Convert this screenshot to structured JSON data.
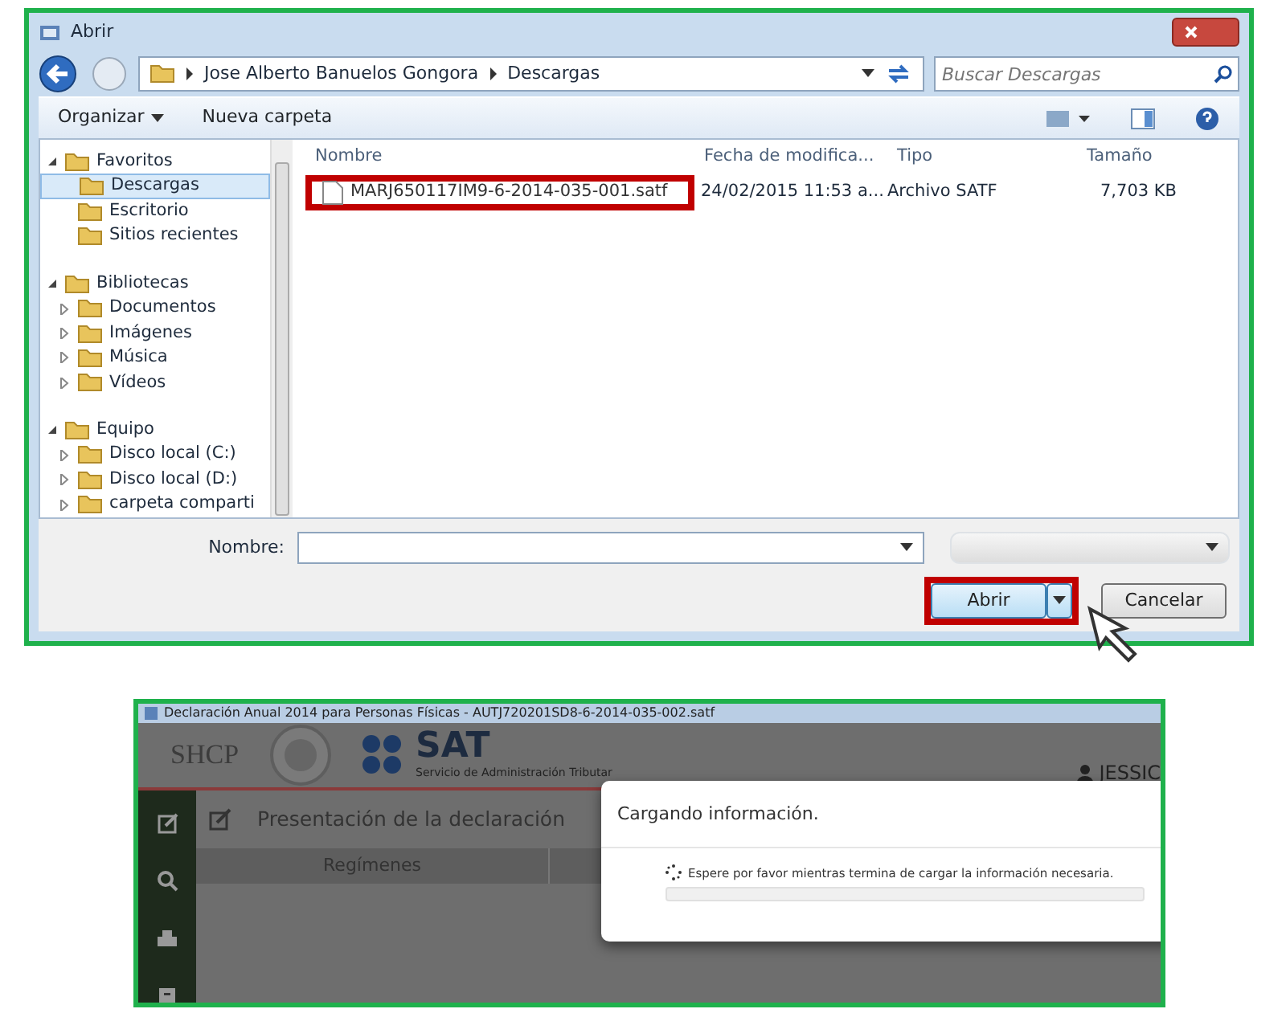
{
  "open_dialog": {
    "title": "Abrir",
    "breadcrumb": [
      "Jose Alberto Banuelos Gongora",
      "Descargas"
    ],
    "search": {
      "placeholder": "Buscar Descargas"
    },
    "toolbar": [
      "Organizar",
      "Nueva carpeta"
    ],
    "nav": [
      {
        "label": "Favoritos",
        "expanded": true,
        "selected": false,
        "children": [
          {
            "label": "Descargas",
            "selected": true
          },
          {
            "label": "Escritorio",
            "selected": false
          },
          {
            "label": "Sitios recientes",
            "selected": false
          }
        ]
      },
      {
        "label": "Bibliotecas",
        "expanded": true,
        "selected": false,
        "children": [
          {
            "label": "Documentos",
            "expanded": false,
            "selected": false
          },
          {
            "label": "Imágenes",
            "expanded": false,
            "selected": false
          },
          {
            "label": "Música",
            "expanded": false,
            "selected": false
          },
          {
            "label": "Vídeos",
            "expanded": false,
            "selected": false
          }
        ]
      },
      {
        "label": "Equipo",
        "expanded": true,
        "selected": false,
        "children": [
          {
            "label": "Disco local (C:)",
            "expanded": false,
            "selected": false
          },
          {
            "label": "Disco local (D:)",
            "expanded": false,
            "selected": false
          },
          {
            "label": "carpeta comparti",
            "expanded": false,
            "selected": false
          }
        ]
      }
    ],
    "columns": [
      "Nombre",
      "Fecha de modifica...",
      "Tipo",
      "Tamaño"
    ],
    "files": [
      {
        "name": "MARJ650117IM9-6-2014-035-001.satf",
        "date": "24/02/2015 11:53 a...",
        "type": "Archivo SATF",
        "size": "7,703 KB",
        "highlighted": true
      }
    ],
    "filename_label": "Nombre:",
    "buttons": [
      {
        "label": "Abrir",
        "kind": "split",
        "highlighted": true
      },
      {
        "label": "Cancelar",
        "kind": "plain",
        "highlighted": false
      }
    ]
  },
  "app": {
    "title": "Declaración Anual 2014 para Personas Físicas - AUTJ720201SD8-6-2014-035-002.satf",
    "logo_left": "SHCP",
    "logo_right": "SAT",
    "logo_right_subtitle": "Servicio de Administración Tributar",
    "user": "JESSIC",
    "heading": "Presentación de la declaración",
    "table_header": "Regímenes",
    "modal": {
      "title": "Cargando información.",
      "message": "Espere por favor mientras termina de cargar la información necesaria.",
      "level": 0
    }
  }
}
